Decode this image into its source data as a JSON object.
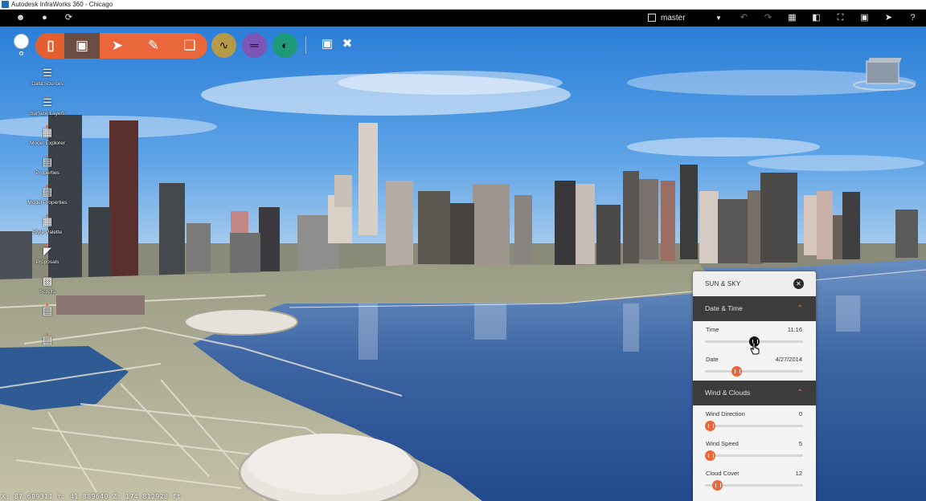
{
  "window": {
    "title": "Autodesk InfraWorks 360 - Chicago"
  },
  "toolbar": {
    "branch_label": "master",
    "icons": [
      "user-icon",
      "globe-icon",
      "sync-icon",
      "branch-icon",
      "undo-icon",
      "redo-icon",
      "map-icon",
      "panel-icon",
      "fullscreen-icon",
      "window-icon",
      "cursor-icon",
      "help-icon"
    ]
  },
  "main_tools": [
    "build-icon",
    "design-icon",
    "select-icon",
    "sketch-icon",
    "layers-icon",
    "roads-icon",
    "bridge-icon",
    "drainage-icon",
    "present-icon",
    "settings-icon"
  ],
  "sidebar": {
    "items": [
      {
        "label": "Data Sources",
        "icon": "database-icon"
      },
      {
        "label": "Surface Layers",
        "icon": "stack-icon"
      },
      {
        "label": "Model Explorer",
        "icon": "explorer-icon"
      },
      {
        "label": "Properties",
        "icon": "properties-icon"
      },
      {
        "label": "Model Properties",
        "icon": "model-properties-icon"
      },
      {
        "label": "Style Palette",
        "icon": "palette-icon"
      },
      {
        "label": "Proposals",
        "icon": "proposals-icon"
      },
      {
        "label": "Scripts",
        "icon": "scripts-icon"
      },
      {
        "label": "",
        "icon": "generic-icon"
      },
      {
        "label": "",
        "icon": "generic-icon"
      }
    ]
  },
  "panel": {
    "title": "SUN & SKY",
    "sections": [
      {
        "label": "Date & Time",
        "rows": [
          {
            "label": "Time",
            "value": "11:16",
            "level": 0.5
          },
          {
            "label": "Date",
            "value": "4/27/2014",
            "level": 0.32
          }
        ]
      },
      {
        "label": "Wind & Clouds",
        "rows": [
          {
            "label": "Wind Direction",
            "value": "0",
            "level": 0
          },
          {
            "label": "Wind Speed",
            "value": "5",
            "level": 0.05
          },
          {
            "label": "Cloud Cover",
            "value": "12",
            "level": 0.12
          }
        ]
      }
    ]
  },
  "status": {
    "coordinates": "X: 87.609311 Y: 41.889640 Z: 174.812928 ft"
  },
  "colors": {
    "accent": "#e9673a",
    "panel_header_dark": "#3c3c3c",
    "toolbar_bg": "#000000"
  }
}
